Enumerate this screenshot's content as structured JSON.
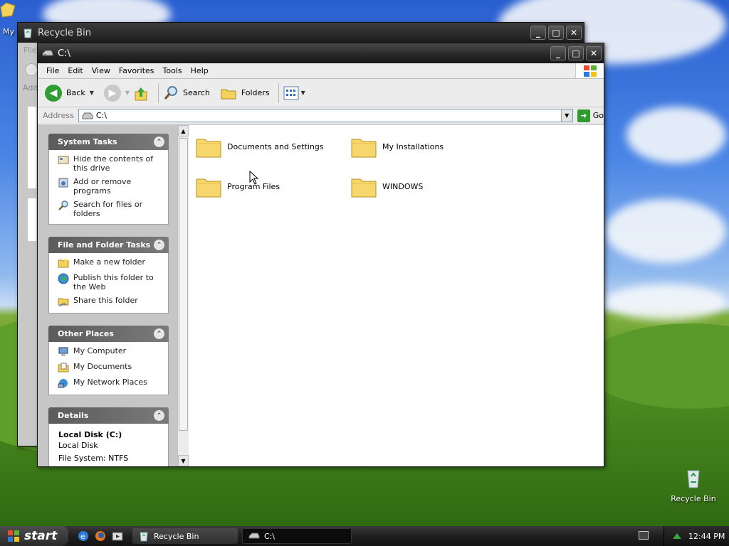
{
  "desktop": {
    "recycle_bin_label": "Recycle Bin",
    "my_label": "My"
  },
  "back_window": {
    "title": "Recycle Bin",
    "menu_first": "File",
    "address_label": "Add"
  },
  "window": {
    "title": "C:\\",
    "menu": [
      "File",
      "Edit",
      "View",
      "Favorites",
      "Tools",
      "Help"
    ],
    "toolbar": {
      "back": "Back",
      "search": "Search",
      "folders": "Folders"
    },
    "address": {
      "label": "Address",
      "value": "C:\\",
      "go": "Go"
    },
    "panels": {
      "system_tasks": {
        "title": "System Tasks",
        "items": [
          "Hide the contents of this drive",
          "Add or remove programs",
          "Search for files or folders"
        ]
      },
      "file_folder_tasks": {
        "title": "File and Folder Tasks",
        "items": [
          "Make a new folder",
          "Publish this folder to the Web",
          "Share this folder"
        ]
      },
      "other_places": {
        "title": "Other Places",
        "items": [
          "My Computer",
          "My Documents",
          "My Network Places"
        ]
      },
      "details": {
        "title": "Details",
        "name": "Local Disk (C:)",
        "type": "Local Disk",
        "filesystem": "File System: NTFS"
      }
    },
    "folders": [
      "Documents and Settings",
      "My Installations",
      "Program Files",
      "WINDOWS"
    ]
  },
  "taskbar": {
    "start": "start",
    "tasks": [
      "Recycle Bin",
      "C:\\"
    ],
    "clock": "12:44 PM"
  },
  "colors": {
    "title_bar": "#262626",
    "panel_header": "#6a6a6a",
    "folder_yellow": "#f5d76e"
  }
}
